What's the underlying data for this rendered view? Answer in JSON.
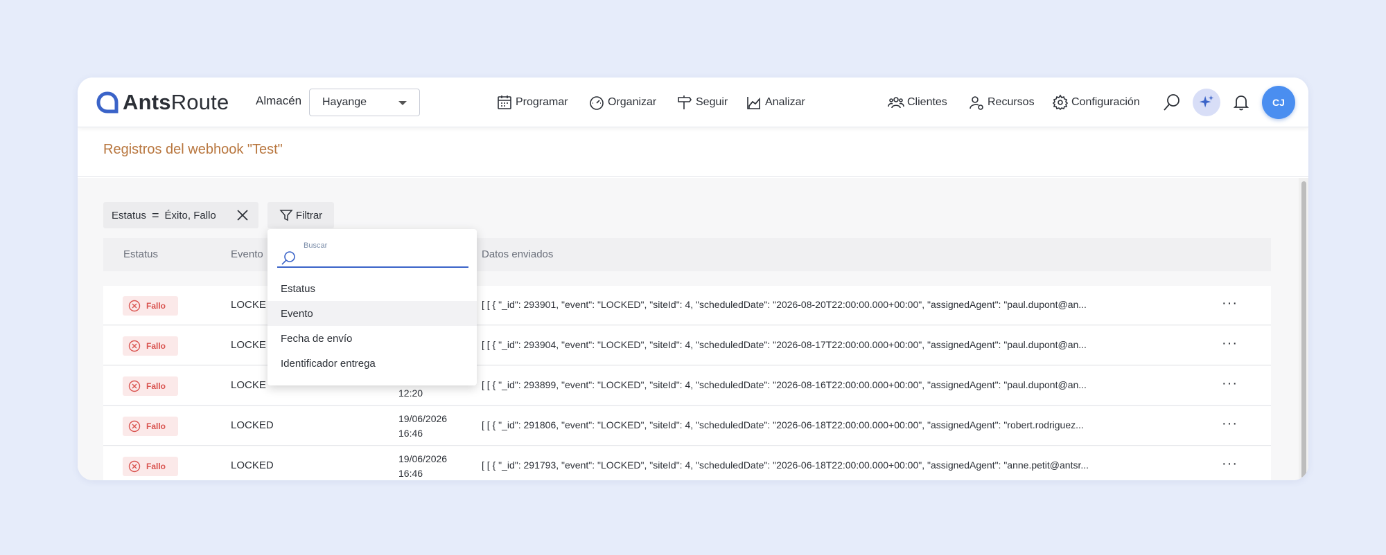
{
  "brand": {
    "name_bold": "Ants",
    "name_rest": "Route"
  },
  "warehouse": {
    "label": "Almacén",
    "value": "Hayange"
  },
  "nav": {
    "programar": "Programar",
    "organizar": "Organizar",
    "seguir": "Seguir",
    "analizar": "Analizar",
    "clientes": "Clientes",
    "recursos": "Recursos",
    "configuracion": "Configuración"
  },
  "user": {
    "initials": "CJ"
  },
  "page": {
    "title": "Registros del webhook \"Test\""
  },
  "filter": {
    "field": "Estatus",
    "operator": "=",
    "value": "Éxito, Fallo",
    "button_label": "Filtrar"
  },
  "table": {
    "headers": {
      "status": "Estatus",
      "event": "Evento",
      "data": "Datos enviados"
    },
    "rows": [
      {
        "status": "Fallo",
        "event": "LOCKE",
        "date": "",
        "time": "",
        "data": "[ [ { \"_id\": 293901, \"event\": \"LOCKED\", \"siteId\": 4, \"scheduledDate\": \"2026-08-20T22:00:00.000+00:00\", \"assignedAgent\": \"paul.dupont@an..."
      },
      {
        "status": "Fallo",
        "event": "LOCKE",
        "date": "",
        "time": "",
        "data": "[ [ { \"_id\": 293904, \"event\": \"LOCKED\", \"siteId\": 4, \"scheduledDate\": \"2026-08-17T22:00:00.000+00:00\", \"assignedAgent\": \"paul.dupont@an..."
      },
      {
        "status": "Fallo",
        "event": "LOCKE",
        "date": "",
        "time": "12:20",
        "data": "[ [ { \"_id\": 293899, \"event\": \"LOCKED\", \"siteId\": 4, \"scheduledDate\": \"2026-08-16T22:00:00.000+00:00\", \"assignedAgent\": \"paul.dupont@an..."
      },
      {
        "status": "Fallo",
        "event": "LOCKED",
        "date": "19/06/2026",
        "time": "16:46",
        "data": "[ [ { \"_id\": 291806, \"event\": \"LOCKED\", \"siteId\": 4, \"scheduledDate\": \"2026-06-18T22:00:00.000+00:00\", \"assignedAgent\": \"robert.rodriguez..."
      },
      {
        "status": "Fallo",
        "event": "LOCKED",
        "date": "19/06/2026",
        "time": "16:46",
        "data": "[ [ { \"_id\": 291793, \"event\": \"LOCKED\", \"siteId\": 4, \"scheduledDate\": \"2026-06-18T22:00:00.000+00:00\", \"assignedAgent\": \"anne.petit@antsr..."
      }
    ],
    "row_action": "···"
  },
  "dropdown": {
    "search_placeholder": "Buscar",
    "options": [
      "Estatus",
      "Evento",
      "Fecha de envío",
      "Identificador entrega"
    ],
    "hovered": "Evento"
  },
  "colors": {
    "accent": "#3a63c8",
    "title": "#b8763e",
    "fail": "#d9534f",
    "fail_bg": "#fbe9e9",
    "avatar": "#4a8ef0"
  }
}
